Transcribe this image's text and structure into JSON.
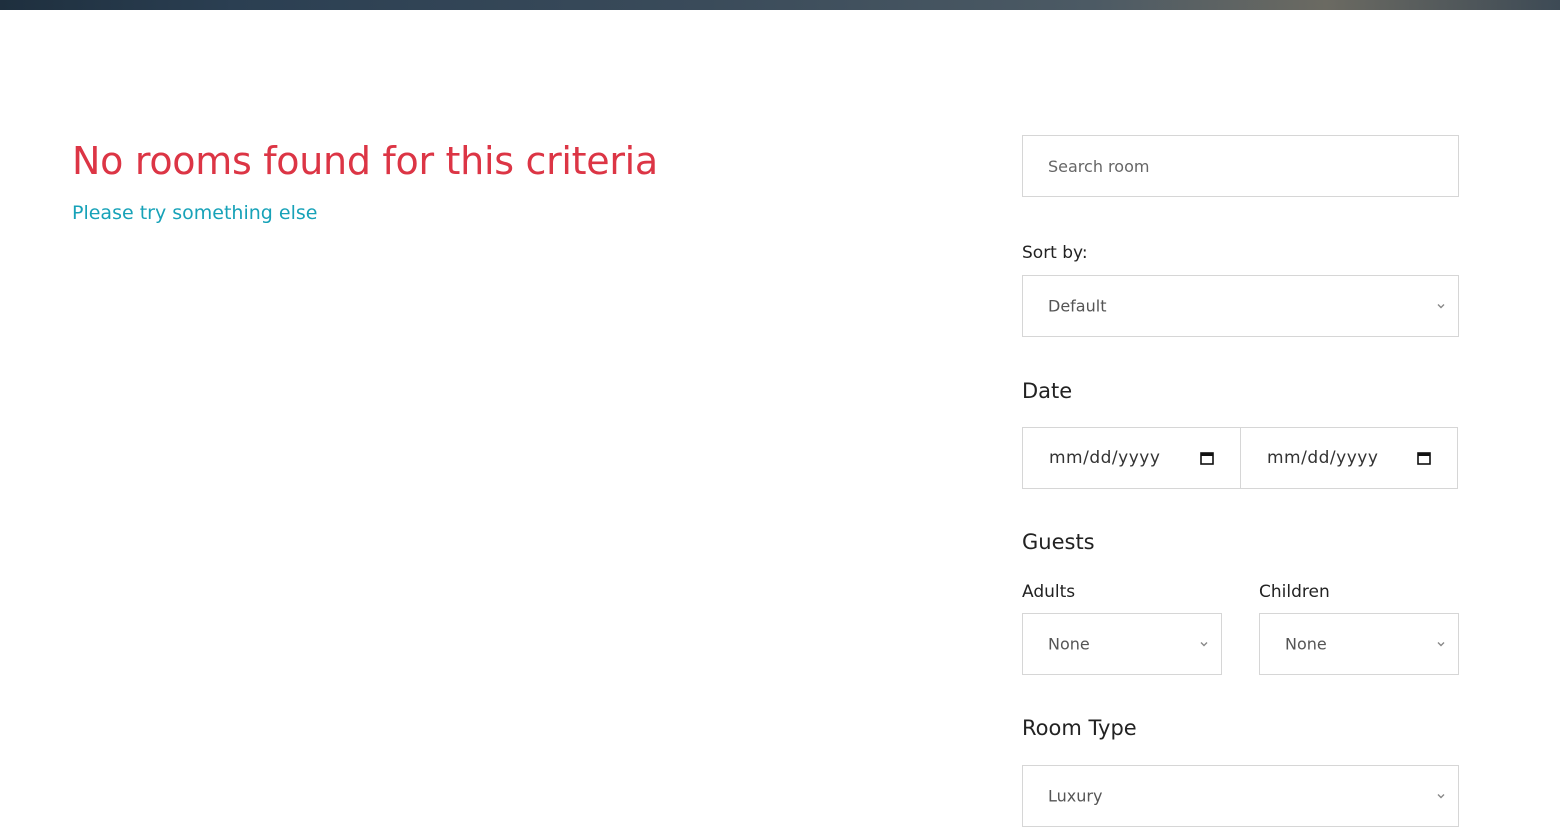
{
  "results": {
    "title": "No rooms found for this criteria",
    "subtitle": "Please try something else"
  },
  "search": {
    "placeholder": "Search room",
    "value": ""
  },
  "sort": {
    "label": "Sort by:",
    "selected": "Default"
  },
  "date": {
    "heading": "Date",
    "checkin_placeholder": "mm/dd/yyyy",
    "checkout_placeholder": "mm/dd/yyyy"
  },
  "guests": {
    "heading": "Guests",
    "adults_label": "Adults",
    "adults_selected": "None",
    "children_label": "Children",
    "children_selected": "None"
  },
  "room_type": {
    "heading": "Room Type",
    "selected": "Luxury"
  },
  "colors": {
    "title_red": "#dc3545",
    "subtitle_teal": "#17a2b8",
    "border": "#d6d6d6"
  },
  "icons": {
    "select_arrow": "chevron-down-icon",
    "date_picker": "calendar-icon"
  }
}
